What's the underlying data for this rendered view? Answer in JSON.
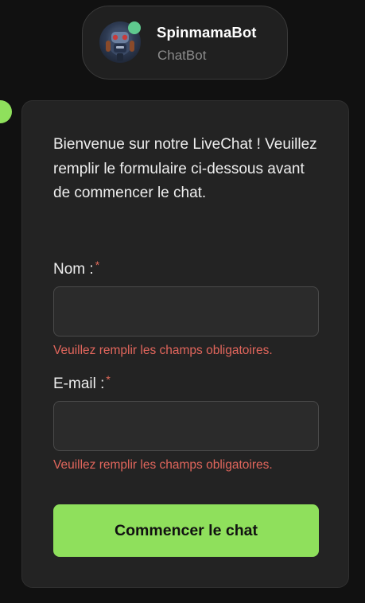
{
  "header": {
    "bot_name": "SpinmamaBot",
    "bot_role": "ChatBot",
    "status_color": "#5fc98e"
  },
  "form": {
    "welcome_text": "Bienvenue sur notre LiveChat ! Veuillez remplir le formulaire ci-dessous avant de commencer le chat.",
    "required_marker": "*",
    "fields": [
      {
        "label": "Nom :",
        "value": "",
        "error": "Veuillez remplir les champs obligatoires."
      },
      {
        "label": "E-mail :",
        "value": "",
        "error": "Veuillez remplir les champs obligatoires."
      }
    ],
    "submit_label": "Commencer le chat"
  },
  "colors": {
    "background": "#111111",
    "card": "#232323",
    "accent": "#8fe05c",
    "error": "#e2665c"
  }
}
